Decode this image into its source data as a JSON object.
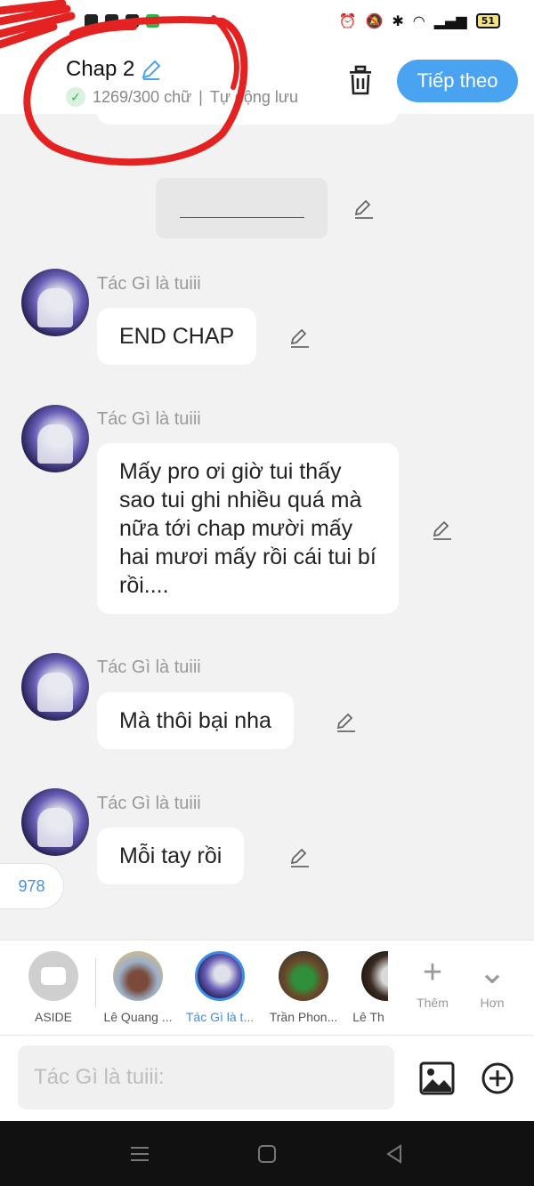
{
  "status_bar": {
    "battery": "51"
  },
  "header": {
    "back_icon": "back-arrow-icon",
    "title": "Chap 2",
    "word_count": "1269/300 chữ",
    "autosave": "Tự động lưu",
    "separator": "|",
    "next_label": "Tiếp theo"
  },
  "messages": [
    {
      "author": "Tác Gì là tuiii",
      "text": "END CHAP"
    },
    {
      "author": "Tác Gì là tuiii",
      "text": "Mấy pro ơi giờ tui thấy sao tui ghi nhiều quá mà nữa tới chap mười mấy hai mươi mấy rồi cái tui bí rồi...."
    },
    {
      "author": "Tác Gì là tuiii",
      "text": "Mà thôi bại nha"
    },
    {
      "author": "Tác Gì là tuiii",
      "text": "Mỗi tay rồi"
    }
  ],
  "floating_counter": "978",
  "characters": [
    {
      "name": "ASIDE"
    },
    {
      "name": "Lê Quang ..."
    },
    {
      "name": "Tác Gì là t..."
    },
    {
      "name": "Trần Phon..."
    },
    {
      "name": "Lê Th"
    }
  ],
  "tools": {
    "add": "Thêm",
    "more": "Hơn"
  },
  "composer": {
    "placeholder": "Tác Gì là tuiii:"
  },
  "colors": {
    "accent": "#4aa3f0",
    "annotation": "#e52222",
    "active_character": "#3d8ee8"
  }
}
